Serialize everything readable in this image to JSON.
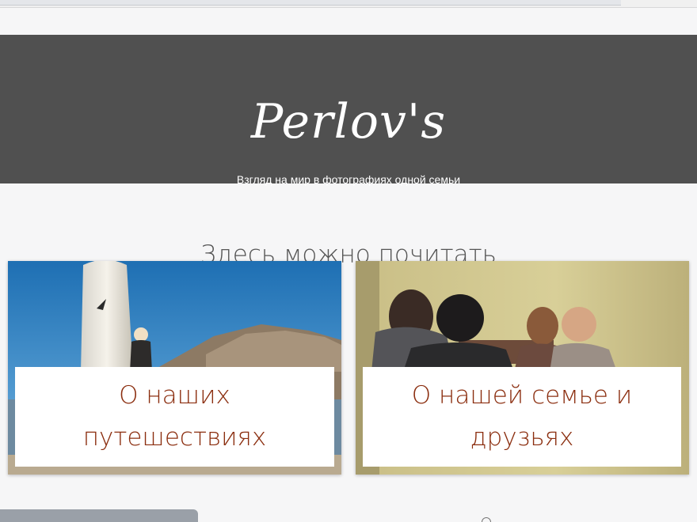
{
  "site": {
    "logo": "Perlov's",
    "tagline": "Взгляд на мир в фотографиях одной семьи"
  },
  "section": {
    "heading": "Здесь можно почитать"
  },
  "cards": [
    {
      "label": "О наших путешествиях"
    },
    {
      "label": "О нашей семье и друзьях"
    }
  ],
  "colors": {
    "header_bg": "#505050",
    "page_bg": "#f6f6f7",
    "card_text": "#8b2e0f",
    "heading_text": "#555555"
  },
  "icons": {
    "travel_photo": "surfboard-photo",
    "family_photo": "family-photo"
  }
}
